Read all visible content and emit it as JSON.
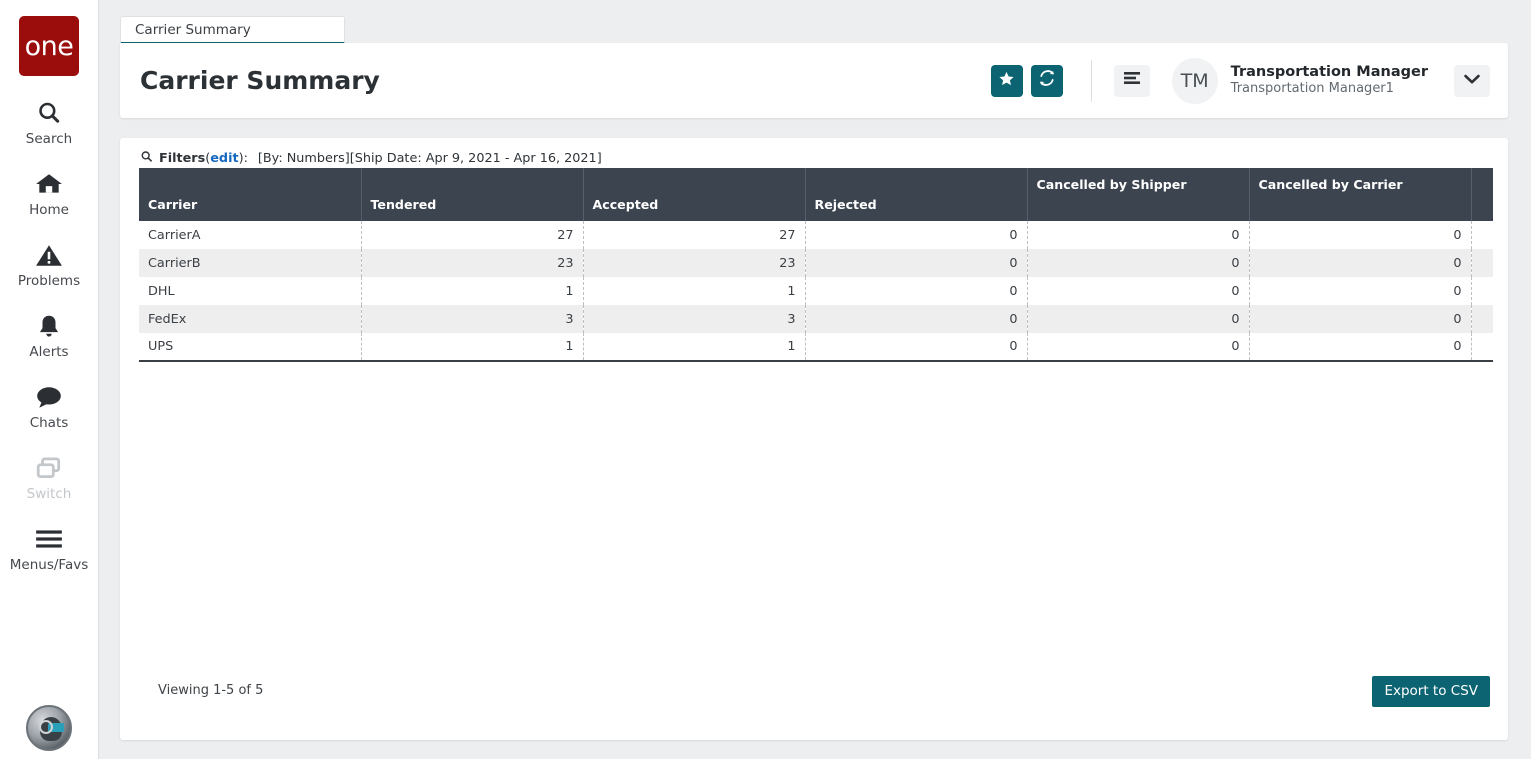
{
  "brand": {
    "logo_text": "one",
    "logo_color": "#9b0d0d"
  },
  "theme": {
    "accent_teal": "#0c6473",
    "table_header": "#3c4450",
    "link_blue": "#1769bf"
  },
  "sidebar": {
    "items": [
      {
        "label": "Search",
        "icon": "search-icon",
        "disabled": false
      },
      {
        "label": "Home",
        "icon": "home-icon",
        "disabled": false
      },
      {
        "label": "Problems",
        "icon": "warning-triangle-icon",
        "disabled": false
      },
      {
        "label": "Alerts",
        "icon": "bell-icon",
        "disabled": false
      },
      {
        "label": "Chats",
        "icon": "chat-bubble-icon",
        "disabled": false
      },
      {
        "label": "Switch",
        "icon": "switch-windows-icon",
        "disabled": true
      },
      {
        "label": "Menus/Favs",
        "icon": "hamburger-icon",
        "disabled": false
      }
    ],
    "assistant_avatar_icon": "assistant-head-icon"
  },
  "tabs": [
    {
      "label": "Carrier Summary",
      "active": true
    }
  ],
  "header": {
    "title": "Carrier Summary",
    "favorite_icon": "star-icon",
    "refresh_icon": "refresh-icon",
    "menu_icon": "list-menu-icon",
    "dropdown_icon": "chevron-down-icon",
    "avatar_initials": "TM",
    "user_name": "Transportation Manager",
    "user_subtitle": "Transportation Manager1"
  },
  "filters": {
    "icon": "search-icon",
    "label": "Filters",
    "edit_label": "edit",
    "open_paren": "(",
    "close_paren": "):",
    "summary": "[By: Numbers][Ship Date: Apr 9, 2021 - Apr 16, 2021]"
  },
  "table": {
    "columns": [
      {
        "label": "Carrier",
        "align": "left",
        "valign": "bottom"
      },
      {
        "label": "Tendered",
        "align": "right",
        "valign": "bottom"
      },
      {
        "label": "Accepted",
        "align": "right",
        "valign": "bottom"
      },
      {
        "label": "Rejected",
        "align": "right",
        "valign": "bottom"
      },
      {
        "label": "Cancelled by Shipper",
        "align": "right",
        "valign": "top"
      },
      {
        "label": "Cancelled by Carrier",
        "align": "right",
        "valign": "top"
      },
      {
        "label": "",
        "align": "right",
        "valign": "top"
      }
    ],
    "rows": [
      {
        "carrier": "CarrierA",
        "tendered": "27",
        "accepted": "27",
        "rejected": "0",
        "cancelled_by_shipper": "0",
        "cancelled_by_carrier": "0",
        "extra": ""
      },
      {
        "carrier": "CarrierB",
        "tendered": "23",
        "accepted": "23",
        "rejected": "0",
        "cancelled_by_shipper": "0",
        "cancelled_by_carrier": "0",
        "extra": ""
      },
      {
        "carrier": "DHL",
        "tendered": "1",
        "accepted": "1",
        "rejected": "0",
        "cancelled_by_shipper": "0",
        "cancelled_by_carrier": "0",
        "extra": ""
      },
      {
        "carrier": "FedEx",
        "tendered": "3",
        "accepted": "3",
        "rejected": "0",
        "cancelled_by_shipper": "0",
        "cancelled_by_carrier": "0",
        "extra": ""
      },
      {
        "carrier": "UPS",
        "tendered": "1",
        "accepted": "1",
        "rejected": "0",
        "cancelled_by_shipper": "0",
        "cancelled_by_carrier": "0",
        "extra": ""
      }
    ]
  },
  "footer": {
    "viewing_text": "Viewing 1-5 of 5",
    "export_label": "Export to CSV"
  }
}
